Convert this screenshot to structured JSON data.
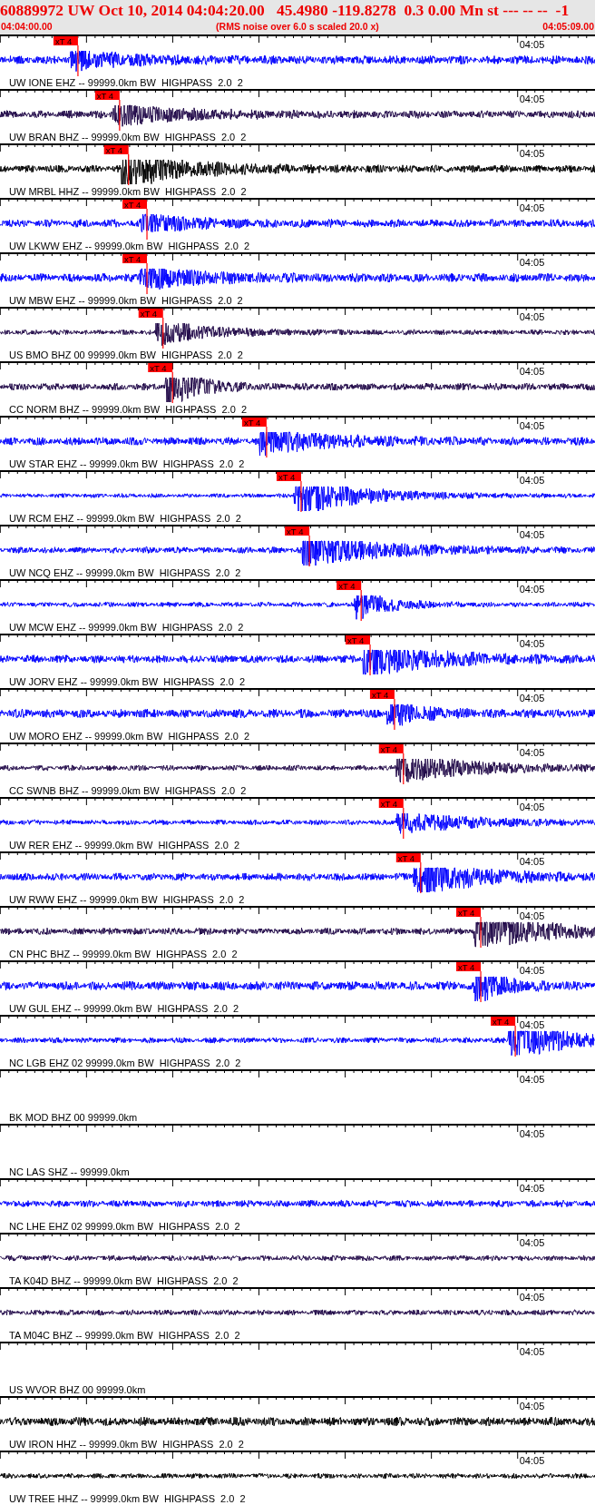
{
  "header": {
    "title": "60889972 UW Oct 10, 2014 04:04:20.00   45.4980 -119.8278  0.3 0.00 Mn st --- -- --  -1",
    "start_time": "04:04:00.00",
    "note": "(RMS noise over 6.0 s scaled 20.0 x)",
    "end_time": "04:05:09.00"
  },
  "traces": [
    {
      "label": "UW IONE EHZ -- 99999.0km BW  HIGHPASS  2.0  2",
      "time_label": "04:05",
      "kind": "waveform",
      "color": "#0000ff",
      "pick": {
        "text": "xT 4",
        "level": 0.131
      }
    },
    {
      "label": "UW BRAN BHZ -- 99999.0km BW  HIGHPASS  2.0  2",
      "time_label": "04:05",
      "kind": "waveform",
      "color": "#200848",
      "pick": {
        "text": "xT 4",
        "level": 0.201
      }
    },
    {
      "label": "UW MRBL HHZ -- 99999.0km BW  HIGHPASS  2.0  2",
      "time_label": "04:05",
      "kind": "waveform",
      "color": "#000000",
      "pick": {
        "text": "xT 4",
        "level": 0.216
      }
    },
    {
      "label": "UW LKWW EHZ -- 99999.0km BW  HIGHPASS  2.0  2",
      "time_label": "04:05",
      "kind": "waveform",
      "color": "#0000ff",
      "pick": {
        "text": "xT 4",
        "level": 0.247
      }
    },
    {
      "label": "UW MBW EHZ -- 99999.0km BW  HIGHPASS  2.0  2",
      "time_label": "04:05",
      "kind": "waveform",
      "color": "#0000ff",
      "pick": {
        "text": "xT 4",
        "level": 0.247
      }
    },
    {
      "label": "US BMO BHZ 00 99999.0km BW  HIGHPASS  2.0  2",
      "time_label": "04:05",
      "kind": "waveform",
      "color": "#200848",
      "pick": {
        "text": "xT 4",
        "level": 0.274
      }
    },
    {
      "label": "CC NORM BHZ -- 99999.0km BW  HIGHPASS  2.0  2",
      "time_label": "04:05",
      "kind": "waveform",
      "color": "#200848",
      "pick": {
        "text": "xT 4",
        "level": 0.29
      }
    },
    {
      "label": "UW STAR EHZ -- 99999.0km BW  HIGHPASS  2.0  2",
      "time_label": "04:05",
      "kind": "waveform",
      "color": "#0000ff",
      "pick": {
        "text": "xT 4",
        "level": 0.448
      }
    },
    {
      "label": "UW RCM EHZ -- 99999.0km BW  HIGHPASS  2.0  2",
      "time_label": "04:05",
      "kind": "waveform",
      "color": "#0000ff",
      "pick": {
        "text": "xT 4",
        "level": 0.506
      }
    },
    {
      "label": "UW NCQ EHZ -- 99999.0km BW  HIGHPASS  2.0  2",
      "time_label": "04:05",
      "kind": "waveform",
      "color": "#0000ff",
      "pick": {
        "text": "xT 4",
        "level": 0.52
      }
    },
    {
      "label": "UW MCW EHZ -- 99999.0km BW  HIGHPASS  2.0  2",
      "time_label": "04:05",
      "kind": "waveform",
      "color": "#0000ff",
      "pick": {
        "text": "xT 4",
        "level": 0.607
      }
    },
    {
      "label": "UW JORV EHZ -- 99999.0km BW  HIGHPASS  2.0  2",
      "time_label": "04:05",
      "kind": "waveform",
      "color": "#0000ff",
      "pick": {
        "text": "xT 4",
        "level": 0.622
      }
    },
    {
      "label": "UW MORO EHZ -- 99999.0km BW  HIGHPASS  2.0  2",
      "time_label": "04:05",
      "kind": "waveform",
      "color": "#0000ff",
      "pick": {
        "text": "xT 4",
        "level": 0.663
      }
    },
    {
      "label": "CC SWNB BHZ -- 99999.0km BW  HIGHPASS  2.0  2",
      "time_label": "04:05",
      "kind": "waveform",
      "color": "#200848",
      "pick": {
        "text": "xT 4",
        "level": 0.678
      }
    },
    {
      "label": "UW RER EHZ -- 99999.0km BW  HIGHPASS  2.0  2",
      "time_label": "04:05",
      "kind": "waveform",
      "color": "#0000ff",
      "pick": {
        "text": "xT 4",
        "level": 0.678
      }
    },
    {
      "label": "UW RWW EHZ -- 99999.0km BW  HIGHPASS  2.0  2",
      "time_label": "04:05",
      "kind": "waveform",
      "color": "#0000ff",
      "pick": {
        "text": "xT 4",
        "level": 0.707
      }
    },
    {
      "label": "CN PHC BHZ -- 99999.0km BW  HIGHPASS  2.0  2",
      "time_label": "04:05",
      "kind": "waveform",
      "color": "#200848",
      "pick": {
        "text": "xT 4",
        "level": 0.808
      }
    },
    {
      "label": "UW GUL EHZ -- 99999.0km BW  HIGHPASS  2.0  2",
      "time_label": "04:05",
      "kind": "waveform",
      "color": "#0000ff",
      "pick": {
        "text": "xT 4",
        "level": 0.808
      }
    },
    {
      "label": "NC LGB EHZ 02 99999.0km BW  HIGHPASS  2.0  2",
      "time_label": "04:05",
      "kind": "waveform",
      "color": "#0000ff",
      "pick": {
        "text": "xT 4",
        "level": 0.866
      }
    },
    {
      "label": "BK MOD BHZ 00 99999.0km",
      "time_label": "04:05",
      "kind": "blank"
    },
    {
      "label": "NC LAS SHZ -- 99999.0km",
      "time_label": "04:05",
      "kind": "blank"
    },
    {
      "label": "NC LHE EHZ 02 99999.0km BW  HIGHPASS  2.0  2",
      "time_label": "04:05",
      "kind": "waveform",
      "color": "#0000ff"
    },
    {
      "label": "TA K04D BHZ -- 99999.0km BW  HIGHPASS  2.0  2",
      "time_label": "04:05",
      "kind": "waveform",
      "color": "#200848"
    },
    {
      "label": "TA M04C BHZ -- 99999.0km BW  HIGHPASS  2.0  2",
      "time_label": "04:05",
      "kind": "waveform",
      "color": "#200848"
    },
    {
      "label": "US WVOR BHZ 00 99999.0km",
      "time_label": "04:05",
      "kind": "blank"
    },
    {
      "label": "UW IRON HHZ -- 99999.0km BW  HIGHPASS  2.0  2",
      "time_label": "04:05",
      "kind": "waveform",
      "color": "#000000"
    },
    {
      "label": "UW TREE HHZ -- 99999.0km BW  HIGHPASS  2.0  2",
      "time_label": "04:05",
      "kind": "waveform",
      "color": "#000000"
    }
  ]
}
